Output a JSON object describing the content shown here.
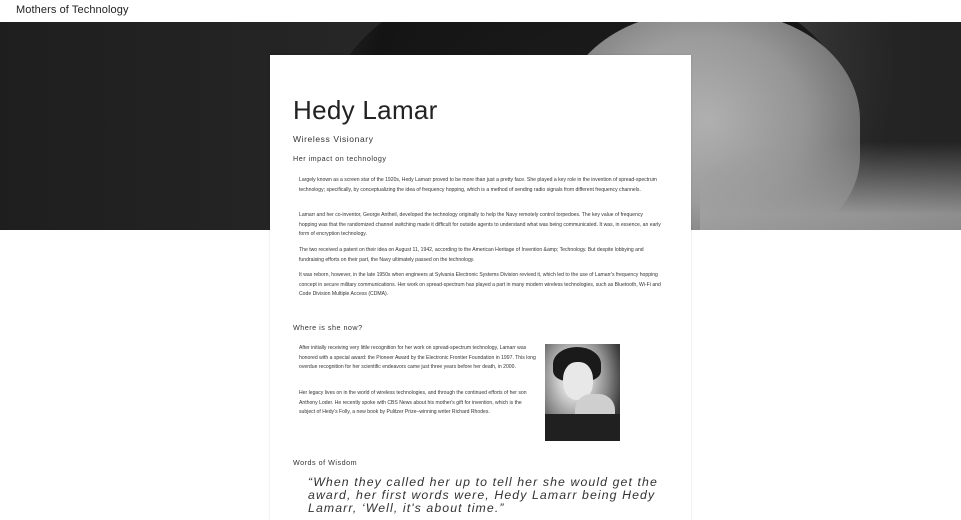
{
  "site": {
    "title": "Mothers of Technology"
  },
  "article": {
    "title": "Hedy Lamar",
    "subtitle": "Wireless Visionary",
    "impact_heading": "Her impact on technology",
    "impact_paragraphs": [
      "Largely known as a screen star of the 1920s, Hedy Lamarr proved to be more than just a pretty face. She played a key role in the invention of spread-spectrum technology; specifically, by conceptualizing the idea of frequency hopping, which is a method of sending radio signals from different frequency channels.",
      "Lamarr and her co-inventor, George Antheil, developed the technology originally to help the Navy remotely control torpedoes. The key value of frequency hopping was that the randomized channel switching made it difficult for outside agents to understand what was being communicated. It was, in essence, an early form of encryption technology.",
      "The two received a patent on their idea on August 11, 1942, according to the American Heritage of Invention &amp; Technology. But despite lobbying and fundraising efforts on their part, the Navy ultimately passed on the technology.",
      "It was reborn, however, in the late 1950s when engineers at Sylvania Electronic Systems Division revived it, which led to the use of Lamarr's frequency hopping concept in secure military communications. Her work on spread-spectrum has played a part in many modern wireless technologies, such as Bluetooth, Wi-Fi and Code Division Multiple Access (CDMA)."
    ],
    "now_heading": "Where is she now?",
    "now_paragraphs": [
      "After initially receiving very little recognition for her work on spread-spectrum technology, Lamarr was honored with a special award: the Pioneer Award by the Electronic Frontier Foundation in 1997. This long overdue recognition for her scientific endeavors came just three years before her death, in 2000.",
      "Her legacy lives on in the world of wireless technologies, and through the continued efforts of her son Anthony Loder. He recently spoke with CBS News about his mother's gift for invention, which is the subject of Hedy's Folly, a new book by Pulitzer Prize–winning writer Richard Rhodes."
    ],
    "photo_icon": "portrait-photo",
    "wisdom_heading": "Words of Wisdom",
    "quote": "“When they called her up to tell her she would get the award, her first words were, Hedy Lamarr being Hedy Lamarr, ‘Well, it's about time.”"
  },
  "hero": {
    "icon": "hero-portrait-image"
  }
}
